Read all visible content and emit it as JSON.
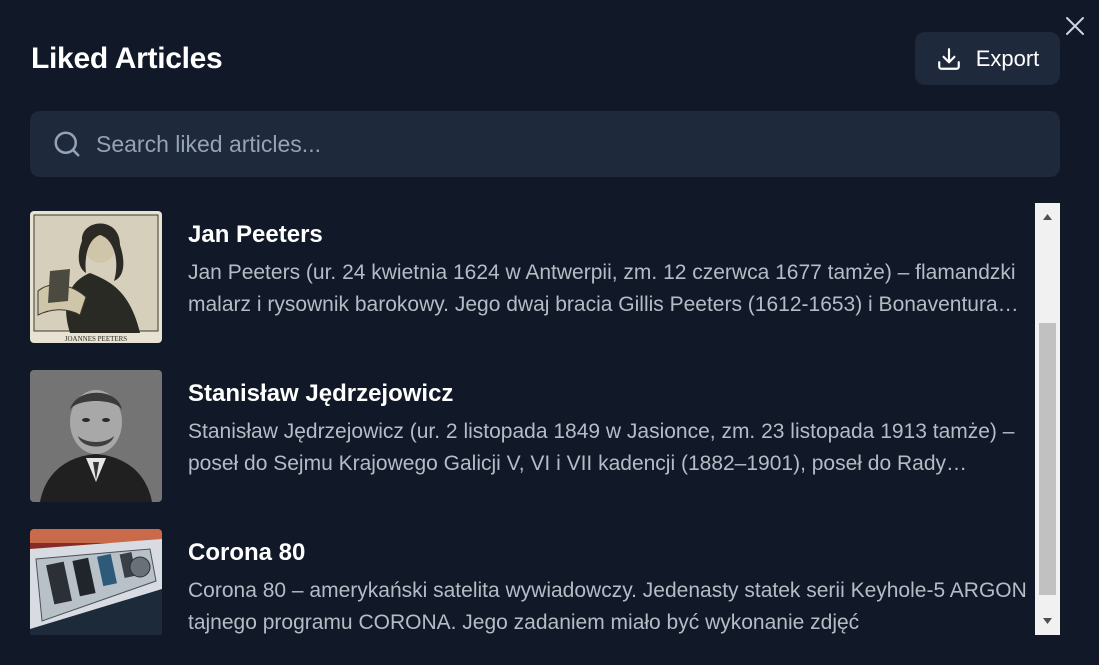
{
  "header": {
    "title": "Liked Articles",
    "export_label": "Export"
  },
  "search": {
    "placeholder": "Search liked articles..."
  },
  "articles": [
    {
      "title": "Jan Peeters",
      "description": "Jan Peeters (ur. 24 kwietnia 1624 w Antwerpii, zm. 12 czerwca 1677 tamże) – flamandzki malarz i rysownik barokowy. Jego dwaj bracia Gillis Peeters (1612-1653) i Bonaventura Peeters",
      "thumbnail_caption": "JOANNES PEETERS"
    },
    {
      "title": "Stanisław Jędrzejowicz",
      "description": "Stanisław Jędrzejowicz (ur. 2 listopada 1849 w Jasionce, zm. 23 listopada 1913 tamże) – poseł do Sejmu Krajowego Galicji V, VI i VII kadencji (1882–1901), poseł do Rady Państwa"
    },
    {
      "title": "Corona 80",
      "description": "Corona 80 – amerykański satelita wywiadowczy. Jedenasty statek serii Keyhole-5 ARGON tajnego programu CORONA. Jego zadaniem miało być wykonanie zdjęć"
    }
  ],
  "colors": {
    "background": "#111827",
    "surface": "#1e293b",
    "text_muted": "#b6bcc6",
    "placeholder": "#94a3b8"
  }
}
